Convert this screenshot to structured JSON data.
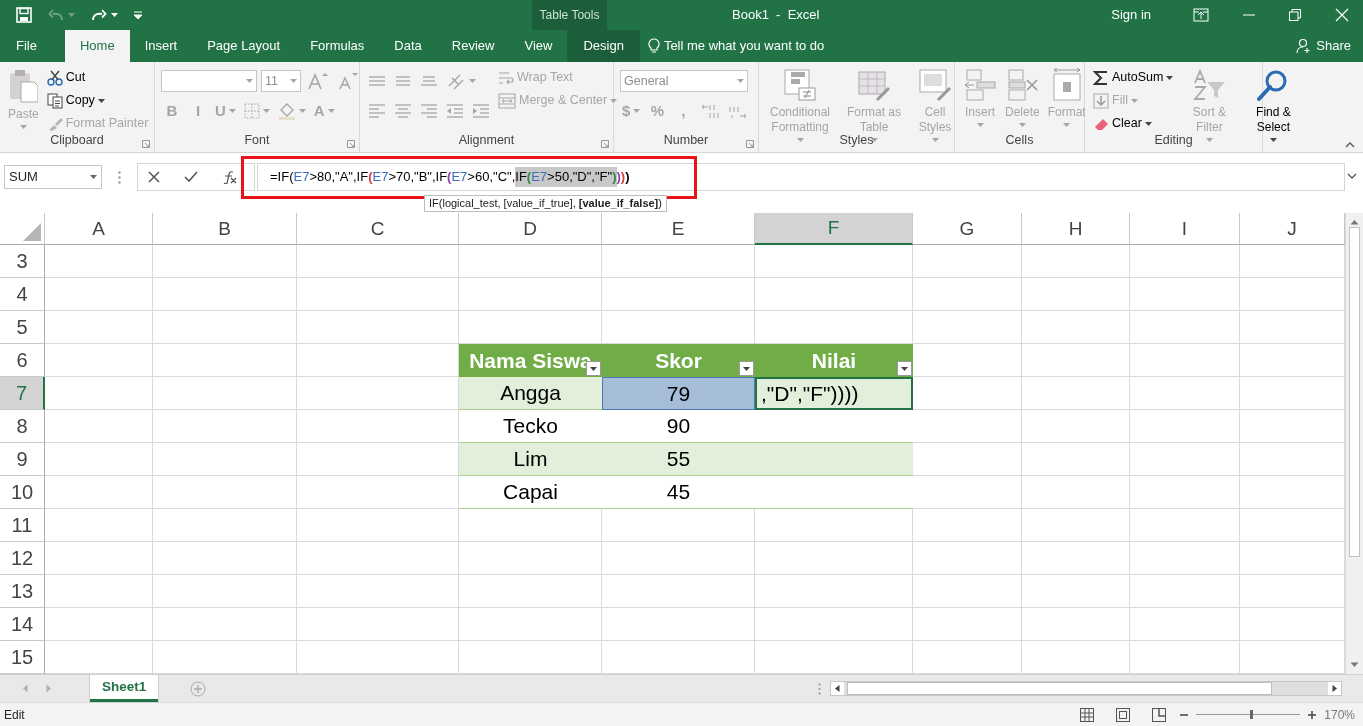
{
  "window": {
    "title": "Book1  -  Excel",
    "context_label": "Table Tools",
    "sign_in": "Sign in"
  },
  "tabs": [
    {
      "label": "File",
      "selected": false,
      "kind": "file"
    },
    {
      "label": "Home",
      "selected": true,
      "kind": "normal"
    },
    {
      "label": "Insert",
      "selected": false,
      "kind": "normal"
    },
    {
      "label": "Page Layout",
      "selected": false,
      "kind": "normal"
    },
    {
      "label": "Formulas",
      "selected": false,
      "kind": "normal"
    },
    {
      "label": "Data",
      "selected": false,
      "kind": "normal"
    },
    {
      "label": "Review",
      "selected": false,
      "kind": "normal"
    },
    {
      "label": "View",
      "selected": false,
      "kind": "normal"
    },
    {
      "label": "Design",
      "selected": false,
      "kind": "context"
    }
  ],
  "tell_me": "Tell me what you want to do",
  "share": "Share",
  "ribbon": [
    {
      "label": "Clipboard",
      "launcher": true,
      "columns": [
        {
          "items": [
            {
              "kind": "large",
              "label": "Paste",
              "disabled": true,
              "caret": true
            }
          ]
        },
        {
          "items": [
            {
              "kind": "small",
              "label": "Cut",
              "disabled": false,
              "caret": false
            },
            {
              "kind": "small",
              "label": "Copy",
              "disabled": false,
              "caret": true
            },
            {
              "kind": "small",
              "label": "Format Painter",
              "disabled": true,
              "caret": false
            }
          ]
        }
      ]
    },
    {
      "label": "Font",
      "launcher": true,
      "columns": [
        {
          "items": [
            {
              "kind": "row",
              "items": [
                {
                  "kind": "field",
                  "disabled": true,
                  "caret": true
                },
                {
                  "kind": "field",
                  "value": "11",
                  "disabled": true,
                  "caret": true
                },
                {
                  "kind": "icon",
                  "disabled": true,
                  "caret": false
                },
                {
                  "kind": "icon",
                  "disabled": true,
                  "caret": false
                }
              ]
            },
            {
              "kind": "row",
              "items": [
                {
                  "kind": "char",
                  "label": "B",
                  "disabled": true,
                  "caret": false
                },
                {
                  "kind": "char",
                  "label": "I",
                  "disabled": true,
                  "caret": false
                },
                {
                  "kind": "char",
                  "label": "U",
                  "disabled": true,
                  "caret": true
                },
                {
                  "kind": "icon",
                  "disabled": true,
                  "caret": true
                },
                {
                  "kind": "icon",
                  "disabled": true,
                  "caret": true
                },
                {
                  "kind": "char",
                  "label": "A",
                  "disabled": true,
                  "caret": true
                }
              ]
            }
          ]
        }
      ]
    },
    {
      "label": "Alignment",
      "launcher": true,
      "columns": [
        {
          "items": [
            {
              "kind": "row",
              "items": [
                {
                  "kind": "icon",
                  "disabled": true,
                  "caret": false
                },
                {
                  "kind": "icon",
                  "disabled": true,
                  "caret": false
                },
                {
                  "kind": "icon",
                  "disabled": true,
                  "caret": false
                },
                {
                  "kind": "icon",
                  "disabled": true,
                  "caret": true
                }
              ]
            },
            {
              "kind": "row",
              "items": [
                {
                  "kind": "icon",
                  "disabled": true,
                  "caret": false
                },
                {
                  "kind": "icon",
                  "disabled": true,
                  "caret": false
                },
                {
                  "kind": "icon",
                  "disabled": true,
                  "caret": false
                },
                {
                  "kind": "icon",
                  "disabled": true,
                  "caret": false
                },
                {
                  "kind": "icon",
                  "disabled": true,
                  "caret": false
                }
              ]
            }
          ]
        },
        {
          "items": [
            {
              "kind": "small",
              "label": "Wrap Text",
              "disabled": true,
              "caret": false
            },
            {
              "kind": "small",
              "label": "Merge & Center",
              "disabled": true,
              "caret": true
            }
          ]
        }
      ]
    },
    {
      "label": "Number",
      "launcher": true,
      "columns": [
        {
          "items": [
            {
              "kind": "row",
              "items": [
                {
                  "kind": "field",
                  "value": "General",
                  "disabled": true,
                  "caret": true
                }
              ]
            },
            {
              "kind": "row",
              "items": [
                {
                  "kind": "char",
                  "label": "$",
                  "disabled": true,
                  "caret": true
                },
                {
                  "kind": "char",
                  "label": "%",
                  "disabled": true,
                  "caret": false
                },
                {
                  "kind": "char",
                  "label": ",",
                  "disabled": true,
                  "caret": false
                },
                {
                  "kind": "icon",
                  "disabled": true,
                  "caret": false
                },
                {
                  "kind": "icon",
                  "disabled": true,
                  "caret": false
                }
              ]
            }
          ]
        }
      ]
    },
    {
      "label": "Styles",
      "launcher": false,
      "columns": [
        {
          "items": [
            {
              "kind": "large",
              "label": "Conditional Formatting",
              "disabled": true,
              "caret": true
            }
          ]
        },
        {
          "items": [
            {
              "kind": "large",
              "label": "Format as Table",
              "disabled": true,
              "caret": true
            }
          ]
        },
        {
          "items": [
            {
              "kind": "large",
              "label": "Cell Styles",
              "disabled": true,
              "caret": true
            }
          ]
        }
      ]
    },
    {
      "label": "Cells",
      "launcher": false,
      "columns": [
        {
          "items": [
            {
              "kind": "large",
              "label": "Insert",
              "disabled": true,
              "caret": true
            }
          ]
        },
        {
          "items": [
            {
              "kind": "large",
              "label": "Delete",
              "disabled": true,
              "caret": true
            }
          ]
        },
        {
          "items": [
            {
              "kind": "large",
              "label": "Format",
              "disabled": true,
              "caret": true
            }
          ]
        }
      ]
    },
    {
      "label": "Editing",
      "launcher": false,
      "columns": [
        {
          "items": [
            {
              "kind": "small",
              "label": "AutoSum",
              "disabled": false,
              "caret": true
            },
            {
              "kind": "small",
              "label": "Fill",
              "disabled": true,
              "caret": true
            },
            {
              "kind": "small",
              "label": "Clear",
              "disabled": false,
              "caret": true
            }
          ]
        },
        {
          "items": [
            {
              "kind": "large",
              "label": "Sort & Filter",
              "disabled": true,
              "caret": true
            }
          ]
        },
        {
          "items": [
            {
              "kind": "large",
              "label": "Find & Select",
              "disabled": false,
              "caret": true
            }
          ]
        }
      ]
    }
  ],
  "formula_bar": {
    "name_box": "SUM",
    "segments": [
      {
        "text": "=IF(",
        "color": "#000000",
        "highlight": false
      },
      {
        "text": "E7",
        "color": "#3a6dbd",
        "highlight": false
      },
      {
        "text": ">80,\"A\",IF",
        "color": "#000000",
        "highlight": false
      },
      {
        "text": "(",
        "color": "#d83b3b",
        "highlight": false
      },
      {
        "text": "E7",
        "color": "#3a6dbd",
        "highlight": false
      },
      {
        "text": ">70,\"B\",IF",
        "color": "#000000",
        "highlight": false
      },
      {
        "text": "(",
        "color": "#8e44ad",
        "highlight": false
      },
      {
        "text": "E7",
        "color": "#3a6dbd",
        "highlight": false
      },
      {
        "text": ">60,\"C\",",
        "color": "#000000",
        "highlight": false
      },
      {
        "text": "IF",
        "color": "#000000",
        "highlight": true
      },
      {
        "text": "(",
        "color": "#2e8b3a",
        "highlight": true
      },
      {
        "text": "E7",
        "color": "#3a6dbd",
        "highlight": true
      },
      {
        "text": ">50,\"D\",\"F\"",
        "color": "#000000",
        "highlight": true
      },
      {
        "text": ")",
        "color": "#2e8b3a",
        "highlight": true
      },
      {
        "text": ")",
        "color": "#8e44ad",
        "highlight": false
      },
      {
        "text": ")",
        "color": "#d83b3b",
        "highlight": false
      },
      {
        "text": ")",
        "color": "#000000",
        "highlight": false
      }
    ]
  },
  "tooltip": "IF(logical_test, [value_if_true], **[value_if_false]**)",
  "columns": [
    {
      "label": "A",
      "selected": false
    },
    {
      "label": "B",
      "selected": false
    },
    {
      "label": "C",
      "selected": false
    },
    {
      "label": "D",
      "selected": false
    },
    {
      "label": "E",
      "selected": false
    },
    {
      "label": "F",
      "selected": true
    },
    {
      "label": "G",
      "selected": false
    },
    {
      "label": "H",
      "selected": false
    },
    {
      "label": "I",
      "selected": false
    },
    {
      "label": "J",
      "selected": false
    }
  ],
  "rows": [
    {
      "label": "3",
      "selected": false
    },
    {
      "label": "4",
      "selected": false
    },
    {
      "label": "5",
      "selected": false
    },
    {
      "label": "6",
      "selected": false
    },
    {
      "label": "7",
      "selected": true
    },
    {
      "label": "8",
      "selected": false
    },
    {
      "label": "9",
      "selected": false
    },
    {
      "label": "10",
      "selected": false
    },
    {
      "label": "11",
      "selected": false
    },
    {
      "label": "12",
      "selected": false
    },
    {
      "label": "13",
      "selected": false
    },
    {
      "label": "14",
      "selected": false
    },
    {
      "label": "15",
      "selected": false
    }
  ],
  "table": {
    "columns": [
      {
        "label": "Nama Siswa"
      },
      {
        "label": "Skor"
      },
      {
        "label": "Nilai"
      }
    ],
    "rows": [
      {
        "cells": [
          {
            "text": "Angga",
            "referenced": false,
            "selected": false
          },
          {
            "text": "79",
            "referenced": true,
            "selected": false
          },
          {
            "text": ",\"D\",\"F\"))))",
            "referenced": false,
            "selected": true
          }
        ]
      },
      {
        "cells": [
          {
            "text": "Tecko",
            "referenced": false,
            "selected": false
          },
          {
            "text": "90",
            "referenced": false,
            "selected": false
          }
        ]
      },
      {
        "cells": [
          {
            "text": "Lim",
            "referenced": false,
            "selected": false
          },
          {
            "text": "55",
            "referenced": false,
            "selected": false
          }
        ]
      },
      {
        "cells": [
          {
            "text": "Capai",
            "referenced": false,
            "selected": false
          },
          {
            "text": "45",
            "referenced": false,
            "selected": false
          }
        ]
      }
    ]
  },
  "sheets": [
    {
      "label": "Sheet1",
      "selected": true
    }
  ],
  "status_bar": {
    "mode": "Edit",
    "zoom": "170%",
    "zoom_slider": {
      "level": 0.52
    }
  }
}
